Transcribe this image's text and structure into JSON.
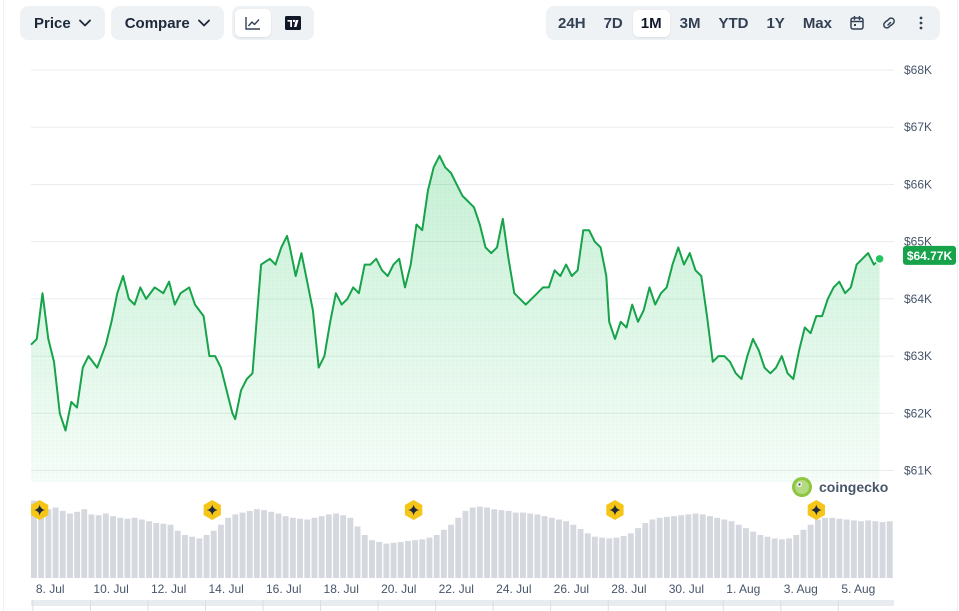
{
  "toolbar": {
    "price_label": "Price",
    "compare_label": "Compare",
    "ranges": [
      "24H",
      "7D",
      "1M",
      "3M",
      "YTD",
      "1Y",
      "Max"
    ],
    "active_range": "1M"
  },
  "watermark": "coingecko",
  "colors": {
    "line": "#16a34a",
    "accent": "#22c55e",
    "badge": "#16a34a",
    "marker": "#f5c518"
  },
  "chart_data": {
    "type": "area",
    "y_tick_labels": [
      "$68K",
      "$67K",
      "$66K",
      "$65K",
      "$64K",
      "$63K",
      "$62K",
      "$61K"
    ],
    "y_ticks": [
      68000,
      67000,
      66000,
      65000,
      64000,
      63000,
      62000,
      61000
    ],
    "ylim": [
      60800,
      68000
    ],
    "x_tick_labels": [
      "8. Jul",
      "10. Jul",
      "12. Jul",
      "14. Jul",
      "16. Jul",
      "18. Jul",
      "20. Jul",
      "22. Jul",
      "24. Jul",
      "26. Jul",
      "28. Jul",
      "30. Jul",
      "1. Aug",
      "3. Aug",
      "5. Aug"
    ],
    "x_tick_days": [
      0.1,
      2.1,
      4.1,
      6.1,
      8.1,
      10.1,
      12.1,
      14.1,
      16.1,
      18.1,
      20.1,
      22.1,
      24.1,
      26.1,
      28.1
    ],
    "x_range_days": [
      0,
      30
    ],
    "current_price_label": "$64.77K",
    "current_price": 64770,
    "price": [
      [
        0.0,
        63200
      ],
      [
        0.2,
        63300
      ],
      [
        0.4,
        64100
      ],
      [
        0.6,
        63300
      ],
      [
        0.8,
        62900
      ],
      [
        1.0,
        62000
      ],
      [
        1.2,
        61700
      ],
      [
        1.4,
        62200
      ],
      [
        1.6,
        62100
      ],
      [
        1.8,
        62800
      ],
      [
        2.0,
        63000
      ],
      [
        2.3,
        62800
      ],
      [
        2.6,
        63200
      ],
      [
        2.8,
        63600
      ],
      [
        3.0,
        64100
      ],
      [
        3.2,
        64400
      ],
      [
        3.4,
        64000
      ],
      [
        3.6,
        63900
      ],
      [
        3.8,
        64200
      ],
      [
        4.0,
        64000
      ],
      [
        4.3,
        64200
      ],
      [
        4.6,
        64100
      ],
      [
        4.8,
        64300
      ],
      [
        5.0,
        63900
      ],
      [
        5.2,
        64100
      ],
      [
        5.5,
        64200
      ],
      [
        5.7,
        63900
      ],
      [
        6.0,
        63700
      ],
      [
        6.2,
        63000
      ],
      [
        6.4,
        63000
      ],
      [
        6.6,
        62800
      ],
      [
        6.8,
        62400
      ],
      [
        7.0,
        62000
      ],
      [
        7.1,
        61900
      ],
      [
        7.3,
        62400
      ],
      [
        7.5,
        62600
      ],
      [
        7.7,
        62700
      ],
      [
        7.9,
        64000
      ],
      [
        8.0,
        64600
      ],
      [
        8.3,
        64700
      ],
      [
        8.5,
        64600
      ],
      [
        8.7,
        64900
      ],
      [
        8.9,
        65100
      ],
      [
        9.0,
        64900
      ],
      [
        9.2,
        64400
      ],
      [
        9.4,
        64800
      ],
      [
        9.6,
        64300
      ],
      [
        9.8,
        63800
      ],
      [
        10.0,
        62800
      ],
      [
        10.2,
        63000
      ],
      [
        10.4,
        63600
      ],
      [
        10.6,
        64100
      ],
      [
        10.8,
        63900
      ],
      [
        11.0,
        64000
      ],
      [
        11.2,
        64200
      ],
      [
        11.4,
        64100
      ],
      [
        11.6,
        64600
      ],
      [
        11.8,
        64600
      ],
      [
        12.0,
        64700
      ],
      [
        12.2,
        64500
      ],
      [
        12.4,
        64400
      ],
      [
        12.6,
        64600
      ],
      [
        12.8,
        64700
      ],
      [
        13.0,
        64200
      ],
      [
        13.2,
        64600
      ],
      [
        13.4,
        65300
      ],
      [
        13.6,
        65200
      ],
      [
        13.8,
        65900
      ],
      [
        14.0,
        66300
      ],
      [
        14.2,
        66500
      ],
      [
        14.4,
        66300
      ],
      [
        14.6,
        66200
      ],
      [
        14.8,
        66000
      ],
      [
        15.0,
        65800
      ],
      [
        15.2,
        65700
      ],
      [
        15.4,
        65600
      ],
      [
        15.6,
        65300
      ],
      [
        15.8,
        64900
      ],
      [
        16.0,
        64800
      ],
      [
        16.2,
        64900
      ],
      [
        16.4,
        65400
      ],
      [
        16.6,
        64700
      ],
      [
        16.8,
        64100
      ],
      [
        17.0,
        64000
      ],
      [
        17.2,
        63900
      ],
      [
        17.4,
        64000
      ],
      [
        17.6,
        64100
      ],
      [
        17.8,
        64200
      ],
      [
        18.0,
        64200
      ],
      [
        18.2,
        64500
      ],
      [
        18.4,
        64400
      ],
      [
        18.6,
        64600
      ],
      [
        18.8,
        64400
      ],
      [
        19.0,
        64500
      ],
      [
        19.2,
        65200
      ],
      [
        19.4,
        65200
      ],
      [
        19.6,
        65000
      ],
      [
        19.8,
        64900
      ],
      [
        20.0,
        64400
      ],
      [
        20.1,
        63600
      ],
      [
        20.3,
        63300
      ],
      [
        20.5,
        63600
      ],
      [
        20.7,
        63500
      ],
      [
        20.9,
        63900
      ],
      [
        21.1,
        63600
      ],
      [
        21.3,
        63800
      ],
      [
        21.5,
        64200
      ],
      [
        21.7,
        63900
      ],
      [
        21.9,
        64100
      ],
      [
        22.1,
        64200
      ],
      [
        22.3,
        64600
      ],
      [
        22.5,
        64900
      ],
      [
        22.7,
        64600
      ],
      [
        22.9,
        64800
      ],
      [
        23.1,
        64500
      ],
      [
        23.3,
        64400
      ],
      [
        23.5,
        63700
      ],
      [
        23.7,
        62900
      ],
      [
        23.9,
        63000
      ],
      [
        24.1,
        63000
      ],
      [
        24.3,
        62900
      ],
      [
        24.5,
        62700
      ],
      [
        24.7,
        62600
      ],
      [
        24.9,
        63000
      ],
      [
        25.1,
        63300
      ],
      [
        25.3,
        63100
      ],
      [
        25.5,
        62800
      ],
      [
        25.7,
        62700
      ],
      [
        25.9,
        62800
      ],
      [
        26.1,
        63000
      ],
      [
        26.3,
        62700
      ],
      [
        26.5,
        62600
      ],
      [
        26.7,
        63100
      ],
      [
        26.9,
        63500
      ],
      [
        27.1,
        63400
      ],
      [
        27.3,
        63700
      ],
      [
        27.5,
        63700
      ],
      [
        27.7,
        64000
      ],
      [
        27.9,
        64200
      ],
      [
        28.1,
        64300
      ],
      [
        28.3,
        64100
      ],
      [
        28.5,
        64200
      ],
      [
        28.7,
        64600
      ],
      [
        28.9,
        64700
      ],
      [
        29.1,
        64800
      ],
      [
        29.3,
        64600
      ],
      [
        29.5,
        64700
      ]
    ],
    "event_marker_days": [
      0.3,
      6.3,
      13.3,
      20.3,
      27.3
    ],
    "volume": [
      0.9,
      0.85,
      0.8,
      0.82,
      0.78,
      0.75,
      0.77,
      0.8,
      0.74,
      0.73,
      0.75,
      0.72,
      0.7,
      0.69,
      0.7,
      0.68,
      0.66,
      0.64,
      0.63,
      0.62,
      0.55,
      0.5,
      0.48,
      0.46,
      0.5,
      0.55,
      0.62,
      0.7,
      0.74,
      0.76,
      0.78,
      0.8,
      0.79,
      0.77,
      0.75,
      0.72,
      0.7,
      0.69,
      0.68,
      0.7,
      0.72,
      0.74,
      0.75,
      0.73,
      0.7,
      0.6,
      0.5,
      0.44,
      0.42,
      0.4,
      0.41,
      0.42,
      0.43,
      0.44,
      0.45,
      0.47,
      0.5,
      0.56,
      0.62,
      0.7,
      0.78,
      0.82,
      0.83,
      0.82,
      0.8,
      0.79,
      0.78,
      0.76,
      0.76,
      0.75,
      0.74,
      0.72,
      0.7,
      0.68,
      0.66,
      0.62,
      0.57,
      0.52,
      0.48,
      0.47,
      0.46,
      0.47,
      0.49,
      0.52,
      0.58,
      0.64,
      0.68,
      0.7,
      0.71,
      0.72,
      0.73,
      0.74,
      0.75,
      0.74,
      0.72,
      0.7,
      0.68,
      0.66,
      0.62,
      0.58,
      0.54,
      0.5,
      0.48,
      0.46,
      0.45,
      0.46,
      0.5,
      0.56,
      0.62,
      0.68,
      0.7,
      0.7,
      0.69,
      0.68,
      0.67,
      0.66,
      0.67,
      0.66,
      0.65,
      0.66
    ]
  }
}
